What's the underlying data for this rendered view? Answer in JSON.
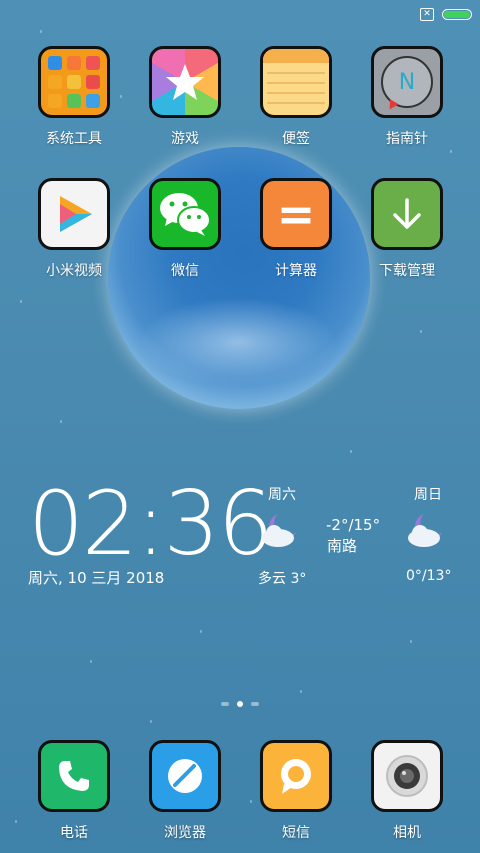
{
  "status_bar": {
    "sim_glyph": "✕",
    "battery_color": "#40d35b"
  },
  "apps_row1": [
    {
      "label": "系统工具",
      "icon": "folder-icon"
    },
    {
      "label": "游戏",
      "icon": "games-star-icon"
    },
    {
      "label": "便签",
      "icon": "notes-icon"
    },
    {
      "label": "指南针",
      "icon": "compass-icon"
    }
  ],
  "apps_row2": [
    {
      "label": "小米视频",
      "icon": "video-play-icon"
    },
    {
      "label": "微信",
      "icon": "wechat-icon"
    },
    {
      "label": "计算器",
      "icon": "calculator-icon"
    },
    {
      "label": "下载管理",
      "icon": "download-icon"
    }
  ],
  "compass_letter": "N",
  "calculator_glyph": "=",
  "clock": {
    "time": "02:36",
    "date": "周六, 10 三月 2018"
  },
  "weather": {
    "day1": "周六",
    "day1_condition": "多云 3°",
    "today_range": "-2°/15°",
    "location": "南路",
    "day2": "周日",
    "day2_range": "0°/13°"
  },
  "page_indicator": {
    "count": 3,
    "active": 2
  },
  "dock": [
    {
      "label": "电话",
      "icon": "phone-icon"
    },
    {
      "label": "浏览器",
      "icon": "browser-icon"
    },
    {
      "label": "短信",
      "icon": "message-icon"
    },
    {
      "label": "相机",
      "icon": "camera-icon"
    }
  ]
}
